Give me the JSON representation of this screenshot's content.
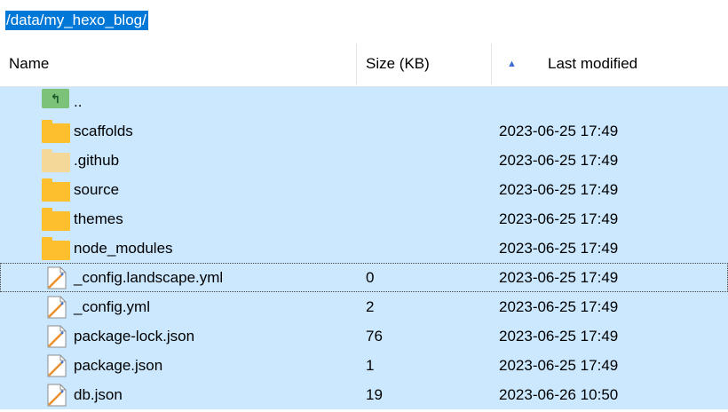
{
  "path": "/data/my_hexo_blog/",
  "columns": {
    "name": "Name",
    "size": "Size (KB)",
    "modified": "Last modified"
  },
  "rows": [
    {
      "name": "..",
      "size": "",
      "modified": "",
      "icon": "parent-dir-icon"
    },
    {
      "name": "scaffolds",
      "size": "",
      "modified": "2023-06-25 17:49",
      "icon": "folder-icon"
    },
    {
      "name": ".github",
      "size": "",
      "modified": "2023-06-25 17:49",
      "icon": "folder-icon"
    },
    {
      "name": "source",
      "size": "",
      "modified": "2023-06-25 17:49",
      "icon": "folder-icon"
    },
    {
      "name": "themes",
      "size": "",
      "modified": "2023-06-25 17:49",
      "icon": "folder-icon"
    },
    {
      "name": "node_modules",
      "size": "",
      "modified": "2023-06-25 17:49",
      "icon": "folder-icon"
    },
    {
      "name": "_config.landscape.yml",
      "size": "0",
      "modified": "2023-06-25 17:49",
      "icon": "file-icon"
    },
    {
      "name": "_config.yml",
      "size": "2",
      "modified": "2023-06-25 17:49",
      "icon": "file-icon"
    },
    {
      "name": "package-lock.json",
      "size": "76",
      "modified": "2023-06-25 17:49",
      "icon": "file-icon"
    },
    {
      "name": "package.json",
      "size": "1",
      "modified": "2023-06-25 17:49",
      "icon": "file-icon"
    },
    {
      "name": "db.json",
      "size": "19",
      "modified": "2023-06-26 10:50",
      "icon": "file-icon"
    }
  ],
  "sort_indicator": "▲",
  "up_icon_glyph": "↰",
  "colors": {
    "selection": "#cce8ff",
    "path_highlight": "#0078d7",
    "folder": "#fdbf2d"
  }
}
